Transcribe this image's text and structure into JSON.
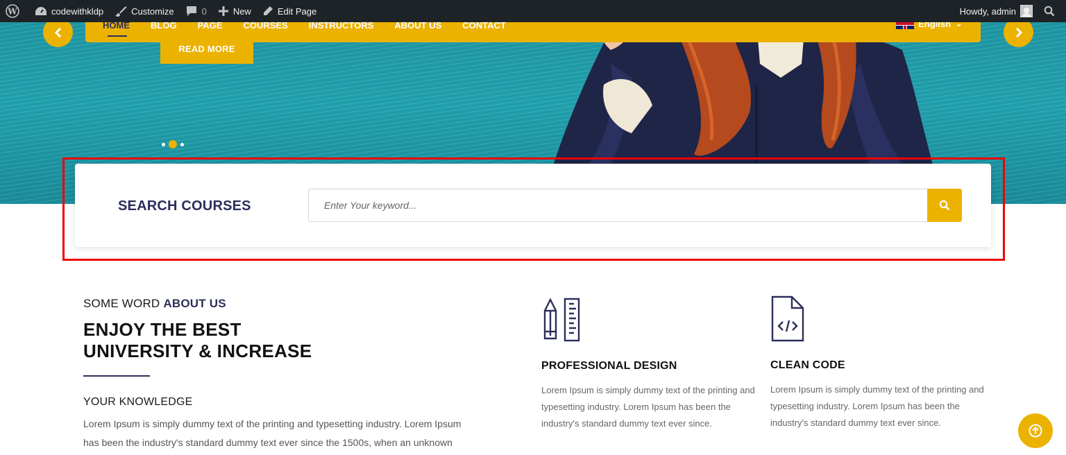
{
  "admin_bar": {
    "site_name": "codewithkldp",
    "customize": "Customize",
    "comments_count": "0",
    "new": "New",
    "edit_page": "Edit Page",
    "howdy": "Howdy, admin"
  },
  "hero": {
    "nav_items": [
      "HOME",
      "BLOG",
      "PAGE",
      "COURSES",
      "INSTRUCTORS",
      "ABOUT US",
      "CONTACT"
    ],
    "language": "English",
    "read_more": "READ MORE",
    "slide_active_index": 1,
    "slide_count": 3
  },
  "search": {
    "title": "SEARCH COURSES",
    "placeholder": "Enter Your keyword..."
  },
  "about": {
    "kicker_prefix": "SOME WORD",
    "kicker_accent": "ABOUT US",
    "heading_line1": "ENJOY THE BEST",
    "heading_line2": "UNIVERSITY & INCREASE",
    "subheading": "YOUR KNOWLEDGE",
    "text_line1": "Lorem Ipsum is simply dummy text of the printing and typesetting industry. Lorem Ipsum",
    "text_line2": "has been the industry's standard dummy text ever since the 1500s, when an unknown"
  },
  "features": [
    {
      "icon": "pencil-ruler-icon",
      "title": "PROFESSIONAL DESIGN",
      "text": "Lorem Ipsum is simply dummy text of the printing and typesetting industry. Lorem Ipsum has been the industry's standard dummy text ever since."
    },
    {
      "icon": "code-file-icon",
      "title": "CLEAN CODE",
      "text": "Lorem Ipsum is simply dummy text of the printing and typesetting industry. Lorem Ipsum has been the industry's standard dummy text ever since."
    }
  ],
  "colors": {
    "accent": "#ecb200",
    "navy": "#2b2e5a",
    "hero_teal": "#1f98a6",
    "highlight": "#ee0000"
  }
}
